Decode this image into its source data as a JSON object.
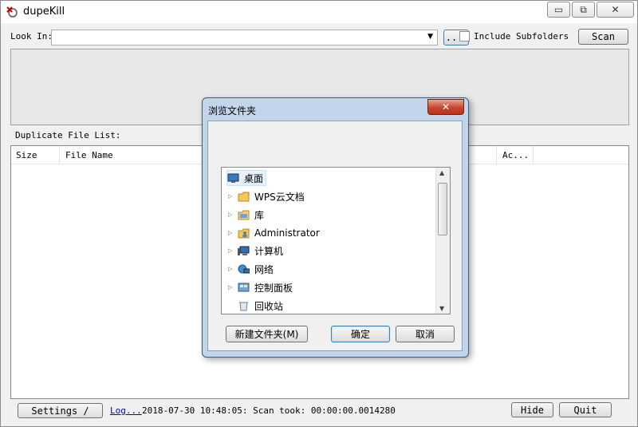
{
  "window": {
    "title": "dupeKill",
    "caption_buttons": {
      "minimize": "▭",
      "restore": "⧉",
      "close": "✕"
    }
  },
  "toolbar": {
    "look_in_label": "Look In:",
    "look_in_value": "",
    "browse_label": "..",
    "include_subfolders_label": "Include Subfolders",
    "include_subfolders_checked": false,
    "scan_label": "Scan"
  },
  "duplicate_list": {
    "label": "Duplicate File List:",
    "columns": [
      "Size",
      "File Name",
      "Ac..."
    ]
  },
  "footer": {
    "settings_label": "Settings /",
    "log_label": "Log...",
    "status_text": "2018-07-30 10:48:05: Scan took: 00:00:00.0014280",
    "hide_label": "Hide",
    "quit_label": "Quit"
  },
  "dialog": {
    "title": "浏览文件夹",
    "close_label": "✕",
    "tree_items": [
      {
        "label": "桌面",
        "icon": "desktop-icon",
        "expandable": false
      },
      {
        "label": "WPS云文档",
        "icon": "folder-icon",
        "expandable": true
      },
      {
        "label": "库",
        "icon": "library-icon",
        "expandable": true
      },
      {
        "label": "Administrator",
        "icon": "user-folder-icon",
        "expandable": true
      },
      {
        "label": "计算机",
        "icon": "computer-icon",
        "expandable": true
      },
      {
        "label": "网络",
        "icon": "network-icon",
        "expandable": true
      },
      {
        "label": "控制面板",
        "icon": "control-panel-icon",
        "expandable": true
      },
      {
        "label": "回收站",
        "icon": "recycle-bin-icon",
        "expandable": false
      }
    ],
    "new_folder_label": "新建文件夹(M)",
    "ok_label": "确定",
    "cancel_label": "取消"
  },
  "colors": {
    "accent": "#3c7fb1",
    "dialog_frame": "#c3d5ea",
    "close_red": "#c7452d",
    "link": "#0000cc"
  }
}
